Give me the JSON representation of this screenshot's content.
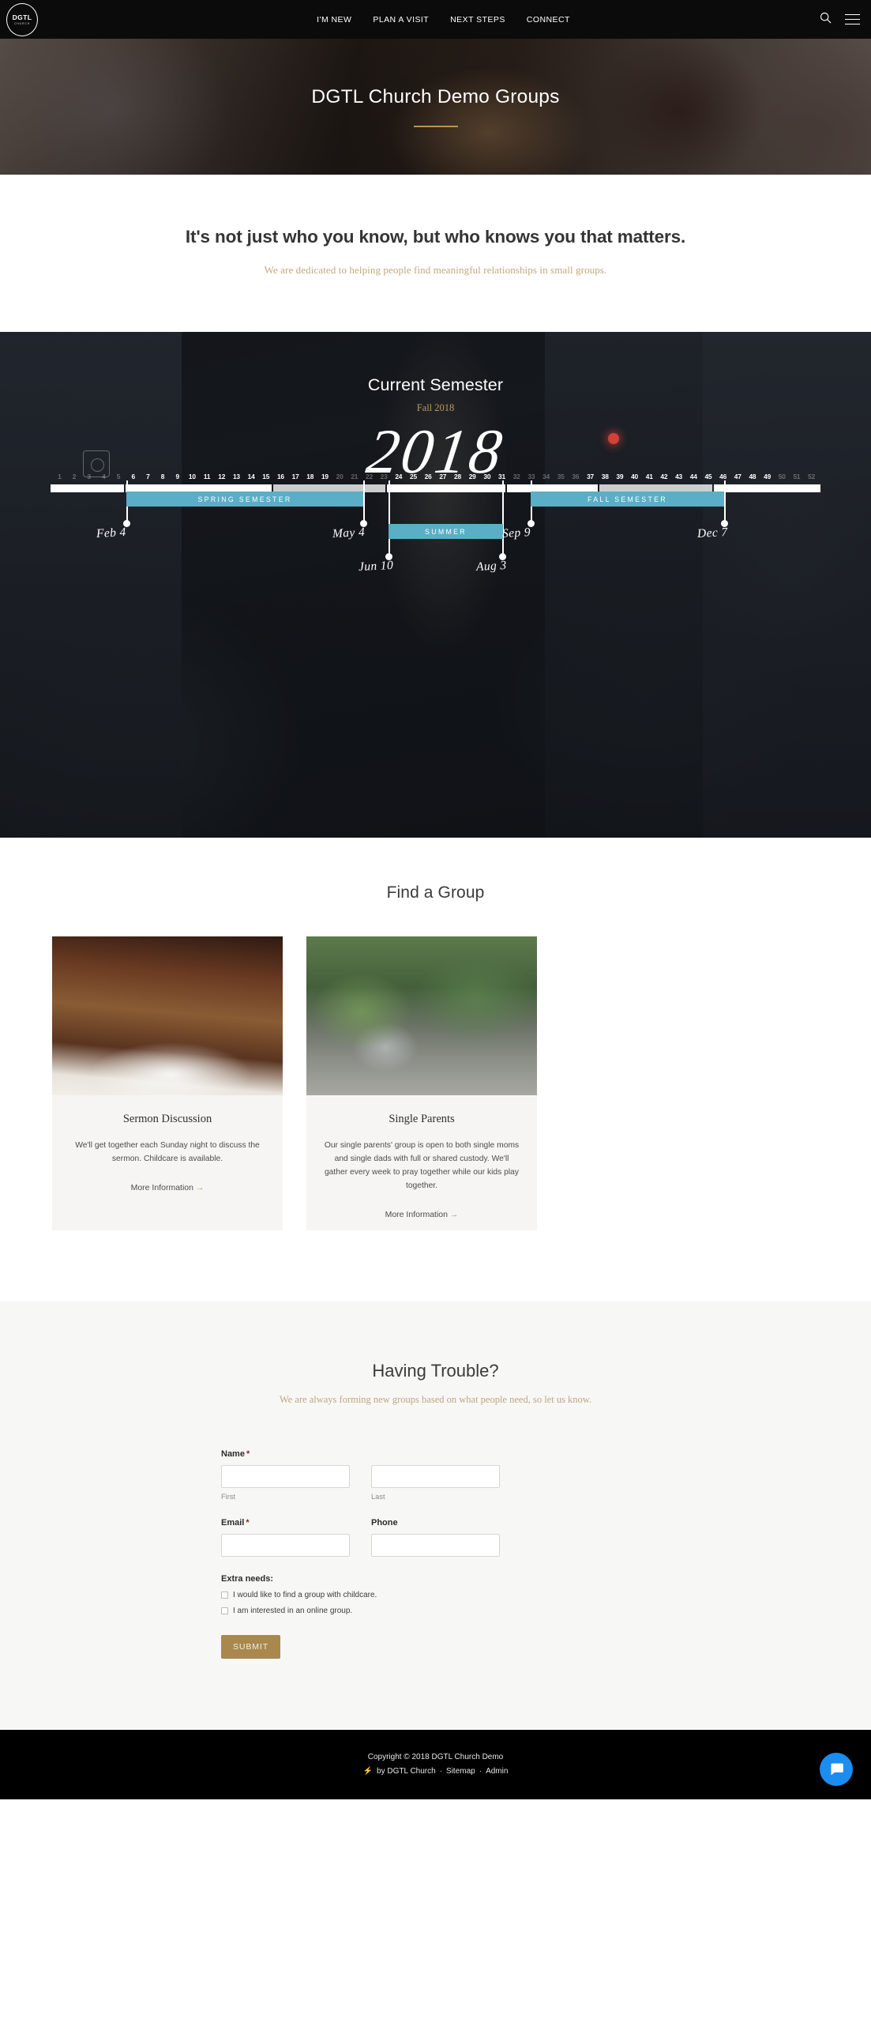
{
  "nav": {
    "logo_top": "DGTL",
    "logo_bottom": "CHURCH",
    "links": [
      {
        "label": "I'M NEW"
      },
      {
        "label": "PLAN A VISIT"
      },
      {
        "label": "NEXT STEPS"
      },
      {
        "label": "CONNECT"
      }
    ],
    "search_icon": "search-icon",
    "menu_icon": "hamburger-menu-icon"
  },
  "hero": {
    "title": "DGTL Church Demo Groups"
  },
  "intro": {
    "heading": "It's not just who you know, but who knows you that matters.",
    "subheading": "We are dedicated to helping people find meaningful relationships in small groups."
  },
  "semester": {
    "heading": "Current Semester",
    "subheading": "Fall 2018",
    "year": "2018",
    "weeks": [
      {
        "n": "1",
        "dim": true
      },
      {
        "n": "2",
        "dim": true
      },
      {
        "n": "3",
        "dim": true
      },
      {
        "n": "4",
        "dim": true
      },
      {
        "n": "5",
        "dim": true
      },
      {
        "n": "6",
        "dim": false
      },
      {
        "n": "7",
        "dim": false
      },
      {
        "n": "8",
        "dim": false
      },
      {
        "n": "9",
        "dim": false
      },
      {
        "n": "10",
        "dim": false
      },
      {
        "n": "11",
        "dim": false
      },
      {
        "n": "12",
        "dim": false
      },
      {
        "n": "13",
        "dim": false
      },
      {
        "n": "14",
        "dim": false
      },
      {
        "n": "15",
        "dim": false
      },
      {
        "n": "16",
        "dim": false
      },
      {
        "n": "17",
        "dim": false
      },
      {
        "n": "18",
        "dim": false
      },
      {
        "n": "19",
        "dim": false
      },
      {
        "n": "20",
        "dim": true
      },
      {
        "n": "21",
        "dim": true
      },
      {
        "n": "22",
        "dim": true
      },
      {
        "n": "23",
        "dim": true
      },
      {
        "n": "24",
        "dim": false
      },
      {
        "n": "25",
        "dim": false
      },
      {
        "n": "26",
        "dim": false
      },
      {
        "n": "27",
        "dim": false
      },
      {
        "n": "28",
        "dim": false
      },
      {
        "n": "29",
        "dim": false
      },
      {
        "n": "30",
        "dim": false
      },
      {
        "n": "31",
        "dim": false
      },
      {
        "n": "32",
        "dim": true
      },
      {
        "n": "33",
        "dim": true
      },
      {
        "n": "34",
        "dim": true
      },
      {
        "n": "35",
        "dim": true
      },
      {
        "n": "36",
        "dim": true
      },
      {
        "n": "37",
        "dim": false
      },
      {
        "n": "38",
        "dim": false
      },
      {
        "n": "39",
        "dim": false
      },
      {
        "n": "40",
        "dim": false
      },
      {
        "n": "41",
        "dim": false
      },
      {
        "n": "42",
        "dim": false
      },
      {
        "n": "43",
        "dim": false
      },
      {
        "n": "44",
        "dim": false
      },
      {
        "n": "45",
        "dim": false
      },
      {
        "n": "46",
        "dim": false
      },
      {
        "n": "47",
        "dim": false
      },
      {
        "n": "48",
        "dim": false
      },
      {
        "n": "49",
        "dim": false
      },
      {
        "n": "50",
        "dim": true
      },
      {
        "n": "51",
        "dim": true
      },
      {
        "n": "52",
        "dim": true
      }
    ],
    "bars": [
      {
        "label": "SPRING SEMESTER",
        "accent": "#5aaec6"
      },
      {
        "label": "SUMMER",
        "accent": "#5aaec6"
      },
      {
        "label": "FALL SEMESTER",
        "accent": "#5aaec6"
      }
    ],
    "markers": [
      {
        "date": "Feb 4"
      },
      {
        "date": "May 4"
      },
      {
        "date": "Jun 10"
      },
      {
        "date": "Aug 3"
      },
      {
        "date": "Sep 9"
      },
      {
        "date": "Dec 7"
      }
    ]
  },
  "groups": {
    "heading": "Find a Group",
    "cards": [
      {
        "title": "Sermon Discussion",
        "body": "We'll get together each Sunday night to discuss the sermon. Childcare is available.",
        "link": "More Information",
        "arrow": "→"
      },
      {
        "title": "Single Parents",
        "body": "Our single parents' group is open to both single moms and single dads with full or shared custody. We'll gather every week to pray together while our kids play together.",
        "link": "More Information",
        "arrow": "→"
      }
    ]
  },
  "form": {
    "heading": "Having Trouble?",
    "subheading": "We are always forming new groups based on what people need, so let us know.",
    "name_label": "Name",
    "name_required": "*",
    "first_sublabel": "First",
    "last_sublabel": "Last",
    "first_value": "",
    "last_value": "",
    "email_label": "Email",
    "email_required": "*",
    "email_value": "",
    "phone_label": "Phone",
    "phone_value": "",
    "extra_label": "Extra needs:",
    "checkboxes": [
      {
        "label": "I would like to find a group with childcare.",
        "checked": false
      },
      {
        "label": "I am interested in an online group.",
        "checked": false
      }
    ],
    "submit_label": "SUBMIT",
    "submit_color": "#a8884c"
  },
  "footer": {
    "copyright": "Copyright © 2018 DGTL Church Demo",
    "bolt_icon": "lightning-bolt-icon",
    "by": "by DGTL Church",
    "sep1": "·",
    "sitemap": "Sitemap",
    "sep2": "·",
    "admin": "Admin",
    "chat_icon": "chat-bubble-icon",
    "chat_color": "#1b8cf0"
  }
}
